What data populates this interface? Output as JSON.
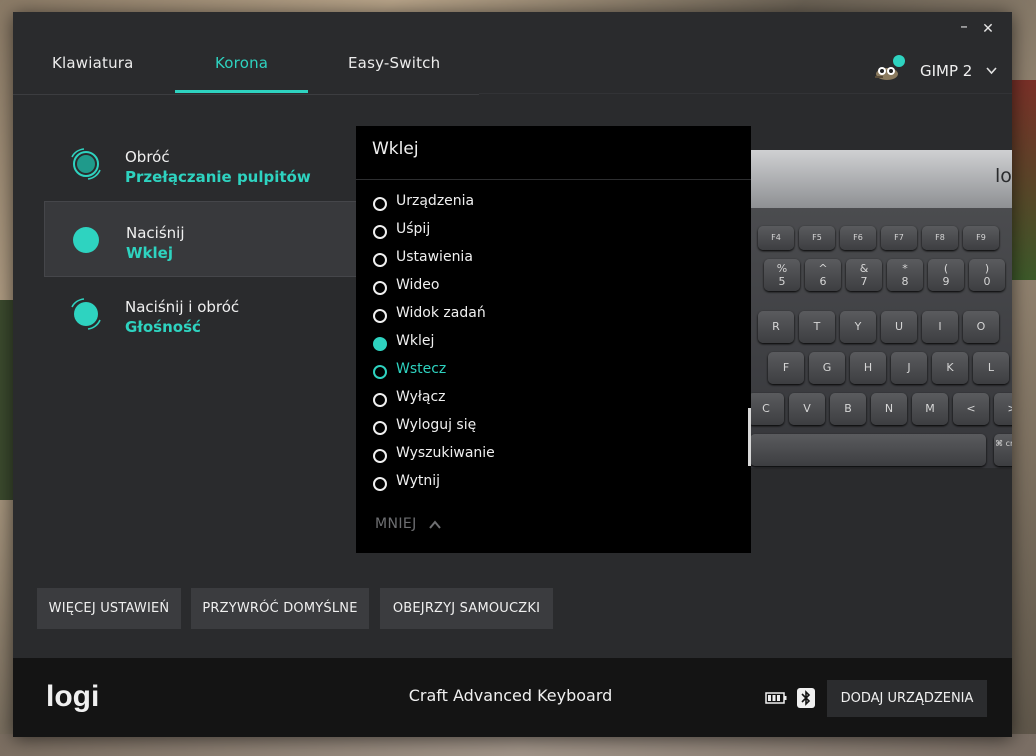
{
  "window": {
    "minimize_glyph": "–",
    "close_glyph": "✕"
  },
  "tabs": [
    {
      "label": "Klawiatura",
      "active": false
    },
    {
      "label": "Korona",
      "active": true
    },
    {
      "label": "Easy-Switch",
      "active": false
    }
  ],
  "app_selector": {
    "app_name": "GIMP 2",
    "icon": "gimp-mascot-icon"
  },
  "crown_actions": [
    {
      "title": "Obróć",
      "subtitle": "Przełączanie pulpitów",
      "icon": "crown-turn-icon",
      "selected": false
    },
    {
      "title": "Naciśnij",
      "subtitle": "Wklej",
      "icon": "crown-press-icon",
      "selected": true
    },
    {
      "title": "Naciśnij i obróć",
      "subtitle": "Głośność",
      "icon": "crown-press-turn-icon",
      "selected": false
    }
  ],
  "dropdown": {
    "title": "Wklej",
    "options": [
      {
        "label": "Urządzenia",
        "state": "off"
      },
      {
        "label": "Uśpij",
        "state": "off"
      },
      {
        "label": "Ustawienia",
        "state": "off"
      },
      {
        "label": "Wideo",
        "state": "off"
      },
      {
        "label": "Widok zadań",
        "state": "off"
      },
      {
        "label": "Wklej",
        "state": "selected"
      },
      {
        "label": "Wstecz",
        "state": "hover"
      },
      {
        "label": "Wyłącz",
        "state": "off"
      },
      {
        "label": "Wyloguj się",
        "state": "off"
      },
      {
        "label": "Wyszukiwanie",
        "state": "off"
      },
      {
        "label": "Wytnij",
        "state": "off"
      }
    ],
    "less_label": "MNIEJ"
  },
  "keyboard_preview": {
    "logo": "lo",
    "fn_keys": [
      "F4",
      "F5",
      "F6",
      "F7",
      "F8",
      "F9"
    ],
    "num_keys": [
      [
        "%",
        "5"
      ],
      [
        "^",
        "6"
      ],
      [
        "&",
        "7"
      ],
      [
        "*",
        "8"
      ],
      [
        "(",
        "9"
      ],
      [
        ")",
        "0"
      ]
    ],
    "row_top": [
      "R",
      "T",
      "Y",
      "U",
      "I",
      "O"
    ],
    "row_home": [
      "F",
      "G",
      "H",
      "J",
      "K",
      "L"
    ],
    "row_bottom": [
      "C",
      "V",
      "B",
      "N",
      "M",
      "<",
      ">"
    ],
    "cmd_key": "⌘ cmd"
  },
  "buttons": {
    "more_settings": "WIĘCEJ USTAWIEŃ",
    "restore_defaults": "PRZYWRÓĆ DOMYŚLNE",
    "watch_tutorials": "OBEJRZYJ SAMOUCZKI"
  },
  "footer": {
    "brand": "logi",
    "device_name": "Craft Advanced Keyboard",
    "add_device": "DODAJ URZĄDZENIA"
  },
  "colors": {
    "accent": "#2ed3c0",
    "background": "#2a2b2d",
    "footer": "#141414",
    "dropdown": "#000000"
  }
}
